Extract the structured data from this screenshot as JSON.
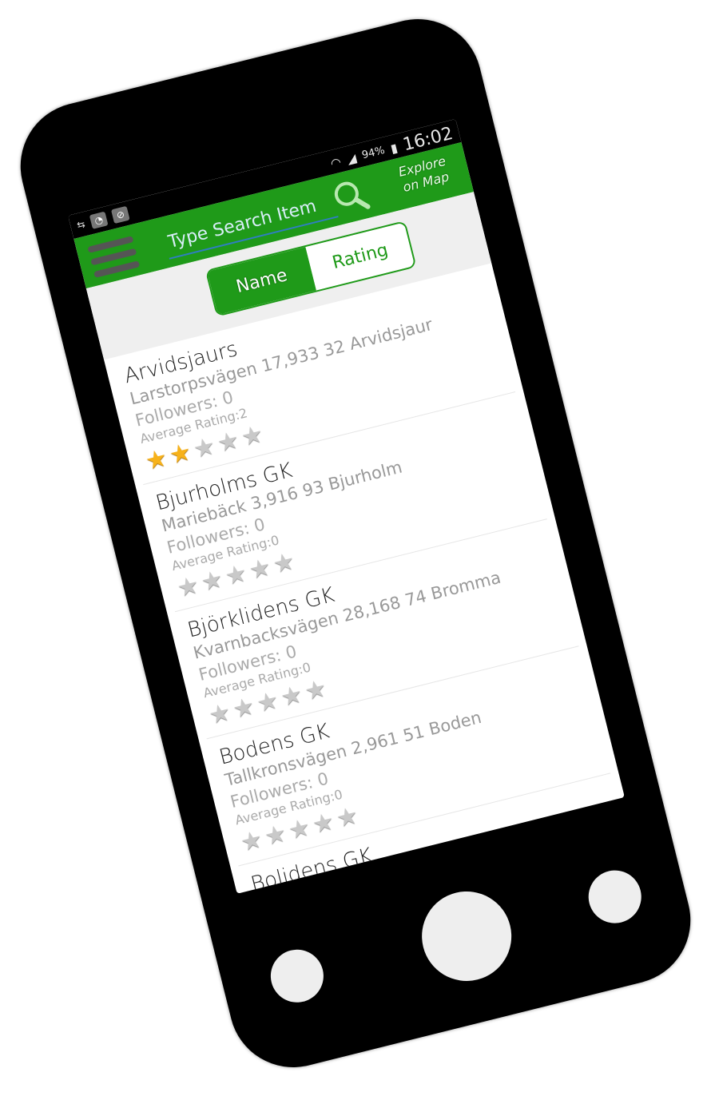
{
  "status_bar": {
    "left_icons": [
      "sync-icon",
      "app-icon-1",
      "app-icon-2"
    ],
    "wifi_icon": "wifi-icon",
    "signal_icon": "signal-icon",
    "battery_percent": "94%",
    "battery_icon": "battery-charging-icon",
    "time": "16:02"
  },
  "app_bar": {
    "menu_icon": "hamburger-icon",
    "search_placeholder": "Type Search Item",
    "search_icon": "magnifier-icon",
    "explore_line1": "Explore",
    "explore_line2": "on Map"
  },
  "sort_tabs": {
    "name_label": "Name",
    "rating_label": "Rating",
    "selected": "Rating"
  },
  "items": [
    {
      "title": "Arvidsjaurs",
      "address": "Larstorpsvägen 17,933 32 Arvidsjaur",
      "followers": "Followers: 0",
      "avg_rating_label": "Average Rating:2",
      "rating": 2
    },
    {
      "title": "Bjurholms GK",
      "address": "Mariebäck 3,916 93 Bjurholm",
      "followers": "Followers: 0",
      "avg_rating_label": "Average Rating:0",
      "rating": 0
    },
    {
      "title": "Björklidens GK",
      "address": "Kvarnbacksvägen 28,168 74 Bromma",
      "followers": "Followers: 0",
      "avg_rating_label": "Average Rating:0",
      "rating": 0
    },
    {
      "title": "Bodens GK",
      "address": "Tallkronsvägen 2,961 51 Boden",
      "followers": "Followers: 0",
      "avg_rating_label": "Average Rating:0",
      "rating": 0
    },
    {
      "title": "Bolidens GK",
      "address": "",
      "followers": "",
      "avg_rating_label": "",
      "rating": 0
    }
  ],
  "colors": {
    "accent_green": "#1f9a19",
    "star_on": "#f7b21a",
    "star_off": "#c9c9c9"
  }
}
